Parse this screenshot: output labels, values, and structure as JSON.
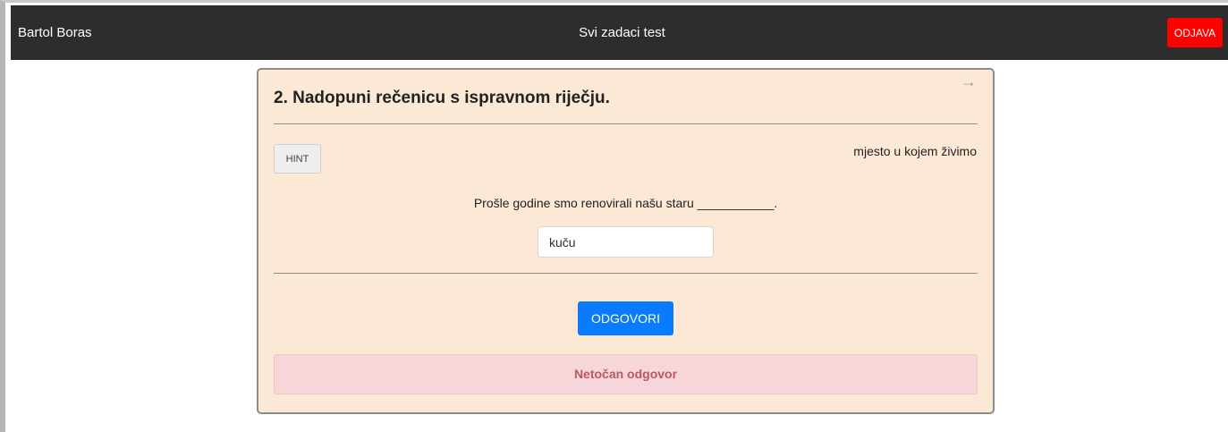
{
  "navbar": {
    "user_name": "Bartol Boras",
    "title": "Svi zadaci test",
    "logout_label": "ODJAVA",
    "logout_color": "#ff0000",
    "background_color": "#2d2d2d"
  },
  "task": {
    "title": "2. Nadopuni rečenicu s ispravnom riječju.",
    "next_icon": "→",
    "hint_label": "HINT",
    "hint_text": "mjesto u kojem živimo",
    "sentence": "Prošle godine smo renovirali našu staru ___________.",
    "answer_value": "kuču",
    "submit_label": "ODGOVORI",
    "submit_color": "#0a7bff",
    "feedback": "Netočan odgovor",
    "card_color": "#fbe9d6",
    "feedback_color": "#f6d6d9"
  }
}
